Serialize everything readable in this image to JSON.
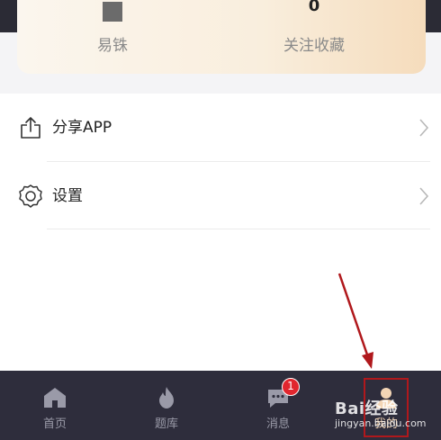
{
  "profile": {
    "stat_left": {
      "label": "易铢"
    },
    "stat_right": {
      "value": "0",
      "label": "关注收藏"
    }
  },
  "menu": {
    "items": [
      {
        "label": "分享APP",
        "icon": "share-icon"
      },
      {
        "label": "设置",
        "icon": "gear-icon"
      }
    ]
  },
  "tabbar": {
    "tabs": [
      {
        "label": "首页",
        "icon": "home-icon"
      },
      {
        "label": "题库",
        "icon": "flame-icon"
      },
      {
        "label": "消息",
        "icon": "chat-icon",
        "badge": "1"
      },
      {
        "label": "我的",
        "icon": "user-icon"
      }
    ]
  },
  "watermark": {
    "logo": "Bai经验",
    "url": "jingyan.baidu.com"
  },
  "colors": {
    "tabbar_bg": "#2e2d3c",
    "active_tab": "#f3d5b5",
    "badge": "#e0262e",
    "annotation_red": "#b0181c"
  }
}
